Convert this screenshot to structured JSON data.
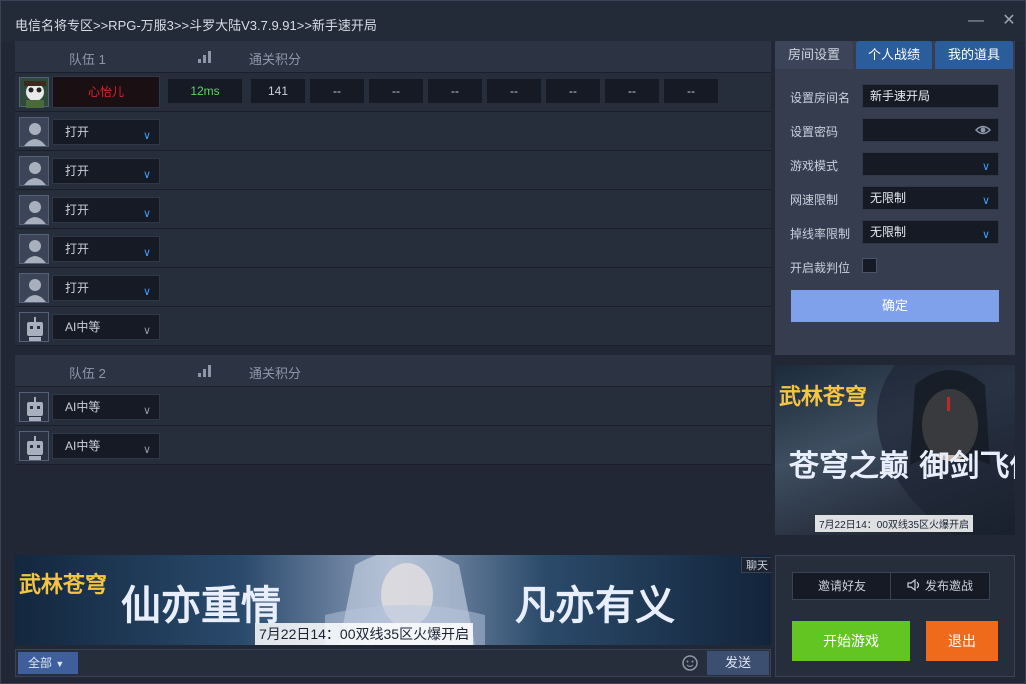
{
  "window": {
    "title": "电信名将专区>>RPG-万服3>>斗罗大陆V3.7.9.91>>新手速开局",
    "minimize": "—",
    "close": "✕"
  },
  "team1": {
    "label": "队伍 1",
    "score_label": "通关积分",
    "player": {
      "name": "心怡儿",
      "ping": "12ms",
      "score": "141",
      "stages": [
        "--",
        "--",
        "--",
        "--",
        "--",
        "--",
        "--"
      ]
    },
    "slots": [
      "打开",
      "打开",
      "打开",
      "打开",
      "打开",
      "AI中等"
    ]
  },
  "team2": {
    "label": "队伍 2",
    "score_label": "通关积分",
    "slots": [
      "AI中等",
      "AI中等"
    ]
  },
  "tabs": [
    "房间设置",
    "个人战绩",
    "我的道具"
  ],
  "room": {
    "name_label": "设置房间名",
    "name_value": "新手速开局",
    "password_label": "设置密码",
    "password_value": "",
    "mode_label": "游戏模式",
    "mode_value": "",
    "speed_label": "网速限制",
    "speed_value": "无限制",
    "drop_label": "掉线率限制",
    "drop_value": "无限制",
    "referee_label": "开启裁判位",
    "confirm": "确定"
  },
  "ads": {
    "right": {
      "logo": "武林苍穹",
      "slogan": "苍穹之巅 御剑飞仙",
      "date": "7月22日14：00双线35区火爆开启"
    },
    "bottom": {
      "logo": "武林苍穹",
      "slogan_left": "仙亦重情",
      "slogan_right": "凡亦有义",
      "date": "7月22日14：00双线35区火爆开启"
    }
  },
  "chat": {
    "label": "聊天",
    "scope": "全部",
    "input": "",
    "send": "发送"
  },
  "actions": {
    "invite": "邀请好友",
    "broadcast": "发布邀战",
    "start": "开始游戏",
    "quit": "退出"
  },
  "colors": {
    "accent_blue": "#2b5d9d",
    "start_green": "#63c521",
    "quit_orange": "#f06a1c",
    "player_name_red": "#e0222a",
    "ping_green": "#5cd65c"
  }
}
